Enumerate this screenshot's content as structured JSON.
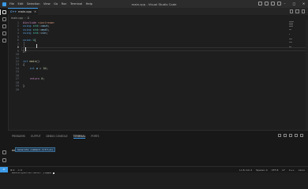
{
  "window": {
    "title": "main.cpp - Visual Studio Code",
    "menu": [
      "File",
      "Edit",
      "Selection",
      "View",
      "Go",
      "Run",
      "Terminal",
      "Help"
    ]
  },
  "tab": {
    "label": "main.cpp",
    "lang_icon": "C++"
  },
  "breadcrumb": [
    "main.cpp",
    "Ω"
  ],
  "editor": {
    "line_numbers": [
      "1",
      "2",
      "3",
      "4",
      "5",
      "6",
      "7",
      "8",
      "9",
      "10",
      "11",
      "12",
      "13",
      "14",
      "15",
      "16",
      "17",
      "18",
      "19",
      "20"
    ],
    "lines": [
      {
        "kind": "pp",
        "text": "#include <iostream>"
      },
      {
        "kind": "using",
        "text": "using std::cout;"
      },
      {
        "kind": "using",
        "text": "using std::endl;"
      },
      {
        "kind": "using",
        "text": "using std::cin;"
      },
      {
        "kind": "blank",
        "text": ""
      },
      {
        "kind": "union",
        "text": "union U{"
      },
      {
        "kind": "blank",
        "text": ""
      },
      {
        "kind": "blank",
        "text": ""
      },
      {
        "kind": "close",
        "text": "};"
      },
      {
        "kind": "blank",
        "text": ""
      },
      {
        "kind": "blank",
        "text": ""
      },
      {
        "kind": "main",
        "text": "int main()"
      },
      {
        "kind": "plain",
        "text": "{"
      },
      {
        "kind": "decl",
        "text": "    int a = 10;"
      },
      {
        "kind": "blank",
        "text": ""
      },
      {
        "kind": "blank",
        "text": ""
      },
      {
        "kind": "ret",
        "text": "    return 0;"
      },
      {
        "kind": "blank",
        "text": ""
      },
      {
        "kind": "plain",
        "text": "}"
      },
      {
        "kind": "blank",
        "text": ""
      }
    ]
  },
  "panel": {
    "tabs": [
      "PROBLEMS",
      "OUTPUT",
      "DEBUG CONSOLE",
      "TERMINAL",
      "PORTS"
    ],
    "active_tab": "TERMINAL",
    "terminal_lines": [
      "master@server-mint:~/cpp$",
      "master@server-mint:~/cpp$"
    ],
    "suggestion": "Generate command (Ctrl+I)"
  },
  "statusbar": {
    "left": [
      "⊗ 0",
      "⚠ 0"
    ],
    "right": [
      "Ln 8, Col 4",
      "Spaces: 4",
      "UTF-8",
      "LF",
      "C++",
      "Linux"
    ]
  },
  "colors": {
    "accent": "#3c9be8",
    "background": "#1e1e1e",
    "keyword": "#569cd6",
    "preprocessor": "#c586c0"
  }
}
